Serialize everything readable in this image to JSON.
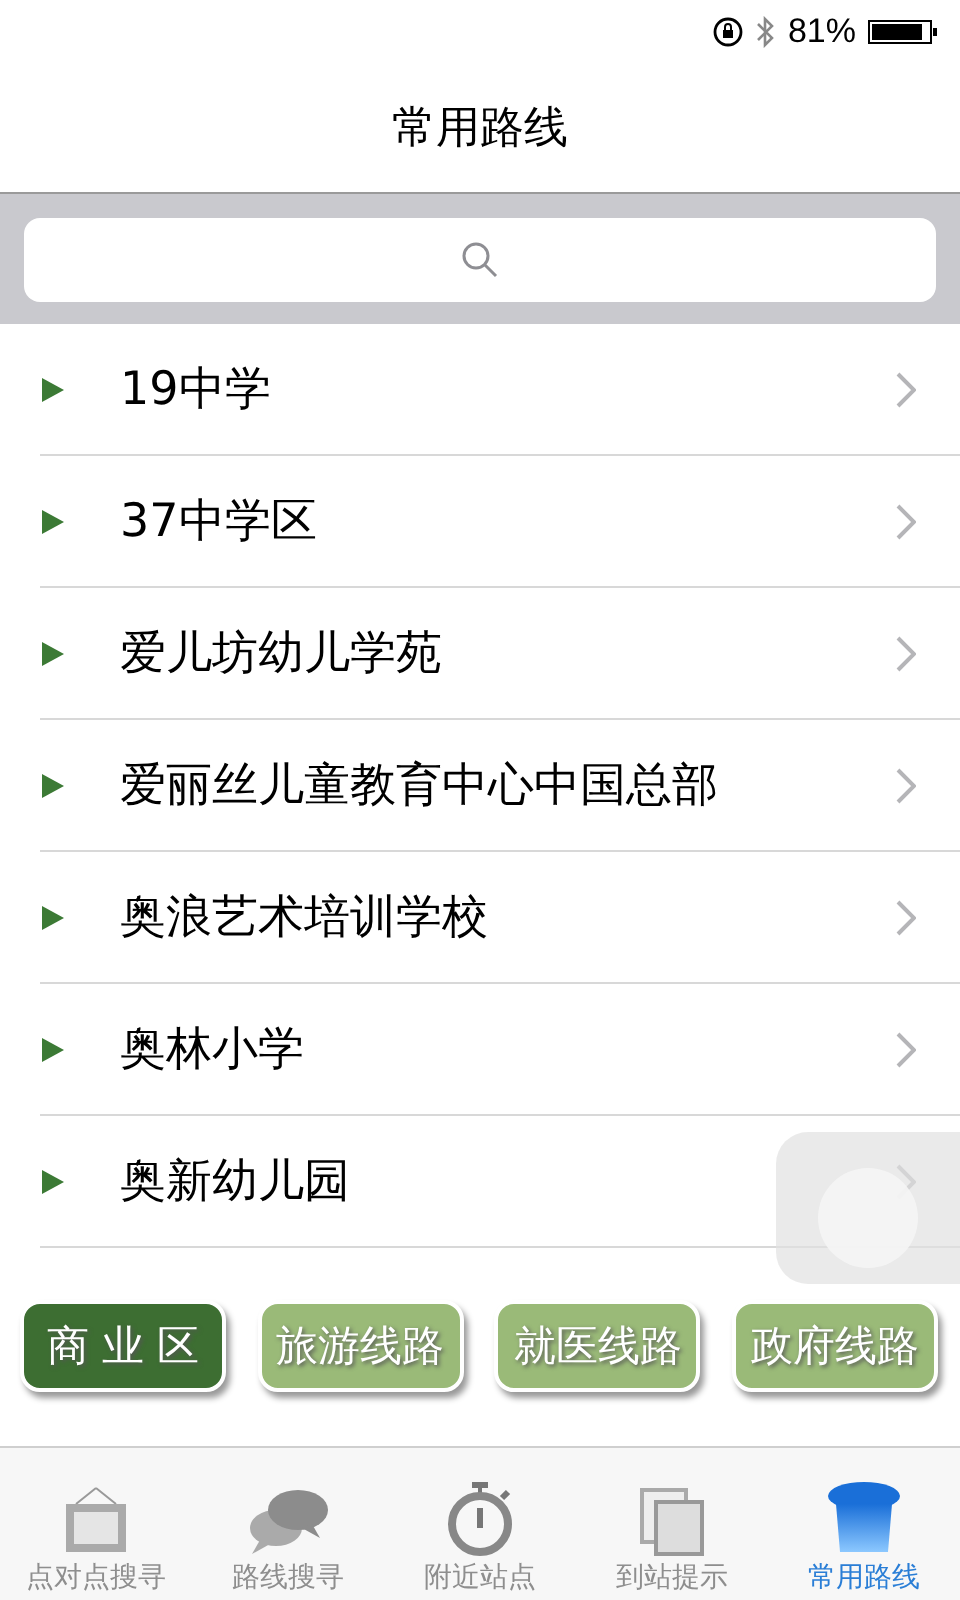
{
  "status_bar": {
    "battery": "81%"
  },
  "title": "常用路线",
  "routes": [
    {
      "name": "19中学"
    },
    {
      "name": "37中学区"
    },
    {
      "name": "爱儿坊幼儿学苑"
    },
    {
      "name": "爱丽丝儿童教育中心中国总部"
    },
    {
      "name": "奥浪艺术培训学校"
    },
    {
      "name": "奥林小学"
    },
    {
      "name": "奥新幼儿园"
    }
  ],
  "categories": [
    {
      "label": "商 业 区",
      "selected": true
    },
    {
      "label": "旅游线路",
      "selected": false
    },
    {
      "label": "就医线路",
      "selected": false
    },
    {
      "label": "政府线路",
      "selected": false
    }
  ],
  "tabs": [
    {
      "label": "点对点搜寻",
      "kind": "frame",
      "selected": false
    },
    {
      "label": "路线搜寻",
      "kind": "chat",
      "selected": false
    },
    {
      "label": "附近站点",
      "kind": "timer",
      "selected": false
    },
    {
      "label": "到站提示",
      "kind": "pages",
      "selected": false
    },
    {
      "label": "常用路线",
      "kind": "hat",
      "selected": true
    }
  ]
}
